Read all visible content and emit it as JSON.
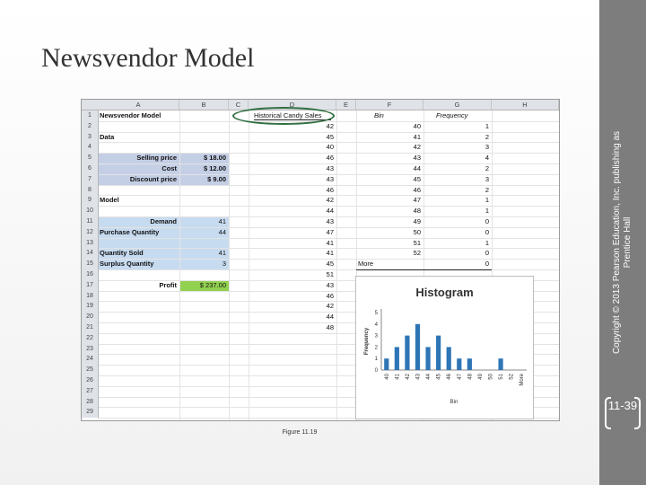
{
  "slide": {
    "title": "Newsvendor Model",
    "copyright": "Copyright © 2013 Pearson Education, Inc. publishing as Prentice Hall",
    "page_number": "11-39",
    "caption": "Figure 11.19"
  },
  "spreadsheet": {
    "columns": [
      "A",
      "B",
      "C",
      "D",
      "E",
      "F",
      "G",
      "H"
    ],
    "rows": [
      "1",
      "2",
      "3",
      "4",
      "5",
      "6",
      "7",
      "8",
      "9",
      "10",
      "11",
      "12",
      "13",
      "14",
      "15",
      "16",
      "17",
      "18",
      "19",
      "20",
      "21",
      "22",
      "23",
      "24",
      "25",
      "26",
      "27",
      "28",
      "29"
    ],
    "a1": "Newsvendor Model",
    "a3": "Data",
    "a9": "Model",
    "data_labels": [
      "Selling price",
      "Cost",
      "Discount price"
    ],
    "data_values": [
      "$  18.00",
      "$  12.00",
      "$    9.00"
    ],
    "model_labels": [
      "Demand",
      "Purchase Quantity",
      "",
      "Quantity Sold",
      "Surplus Quantity"
    ],
    "model_values": [
      "41",
      "44",
      "",
      "41",
      "3"
    ],
    "profit_label": "Profit",
    "profit_value": "$ 237.00",
    "d_header": "Historical Candy Sales",
    "sales": [
      "42",
      "45",
      "40",
      "46",
      "43",
      "43",
      "46",
      "42",
      "44",
      "43",
      "47",
      "41",
      "41",
      "45",
      "51",
      "43",
      "46",
      "42",
      "44",
      "48"
    ],
    "f_header": "Bin",
    "bins": [
      "40",
      "41",
      "42",
      "43",
      "44",
      "45",
      "46",
      "47",
      "48",
      "49",
      "50",
      "51",
      "52"
    ],
    "more_label": "More",
    "g_header": "Frequency",
    "frequencies": [
      "1",
      "2",
      "3",
      "4",
      "2",
      "3",
      "2",
      "1",
      "1",
      "0",
      "0",
      "1",
      "0",
      "0"
    ]
  },
  "chart_data": {
    "type": "bar",
    "title": "Histogram",
    "xlabel": "Bin",
    "ylabel": "Frequency",
    "categories": [
      "40",
      "41",
      "42",
      "43",
      "44",
      "45",
      "46",
      "47",
      "48",
      "49",
      "50",
      "51",
      "52",
      "More"
    ],
    "values": [
      1,
      2,
      3,
      4,
      2,
      3,
      2,
      1,
      1,
      0,
      0,
      1,
      0,
      0
    ],
    "yticks": [
      "0",
      "1",
      "2",
      "3",
      "4",
      "5"
    ],
    "ylim": [
      0,
      5
    ],
    "bar_color": "#2e75b6"
  }
}
